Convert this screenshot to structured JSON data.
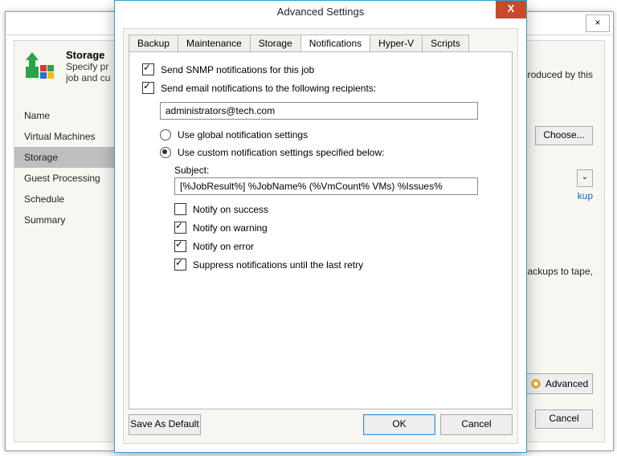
{
  "bg": {
    "close": "×",
    "title": "Storage",
    "subtitle_visible": "Specify pr\njob and cu",
    "right_fragment_files": "files produced by this",
    "choose": "Choose...",
    "link_kup": "kup",
    "tape_fragment": "ng backups to tape,",
    "frag_k": "k",
    "advanced": "Advanced",
    "cancel": "Cancel",
    "sidebar": [
      "Name",
      "Virtual Machines",
      "Storage",
      "Guest Processing",
      "Schedule",
      "Summary"
    ],
    "sidebar_active": 2
  },
  "modal": {
    "title": "Advanced Settings",
    "close": "X",
    "tabs": [
      "Backup",
      "Maintenance",
      "Storage",
      "Notifications",
      "Hyper-V",
      "Scripts"
    ],
    "active_tab": 3,
    "snmp_label": "Send SNMP notifications for this job",
    "email_label": "Send email notifications to the following recipients:",
    "email_value": "administrators@tech.com",
    "radio_global": "Use global notification settings",
    "radio_custom": "Use custom notification settings specified below:",
    "subject_label": "Subject:",
    "subject_value": "[%JobResult%] %JobName% (%VmCount% VMs) %Issues%",
    "notify_success": "Notify on success",
    "notify_warning": "Notify on warning",
    "notify_error": "Notify on error",
    "suppress": "Suppress notifications until the last retry",
    "save_default": "Save As Default",
    "ok": "OK",
    "cancel": "Cancel",
    "checks": {
      "snmp": true,
      "email": true,
      "radio_sel": "custom",
      "success": false,
      "warning": true,
      "error": true,
      "suppress": true
    }
  }
}
